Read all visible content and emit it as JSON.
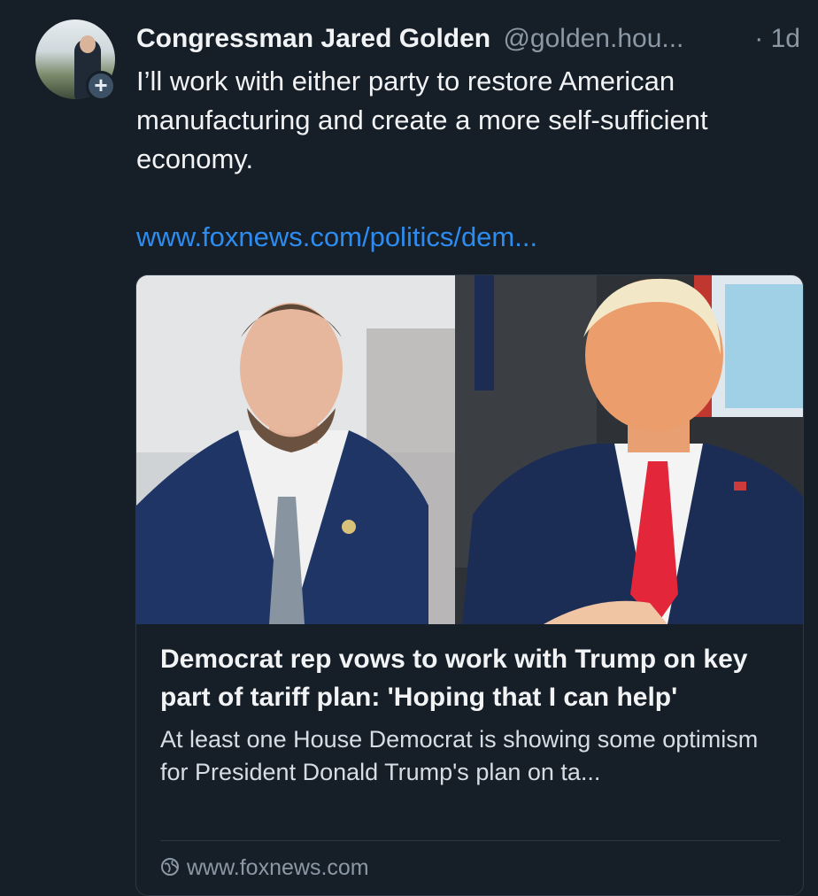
{
  "post": {
    "author_name": "Congressman Jared Golden",
    "author_handle": "@golden.hou...",
    "timestamp": "· 1d",
    "text": "I’ll work with either party to restore American manufacturing and create a more self-sufficient economy.",
    "link_text": "www.foxnews.com/politics/dem...",
    "follow_icon": "plus-icon"
  },
  "card": {
    "title": "Democrat rep vows to work with Trump on key part of tariff plan: 'Hoping that I can help'",
    "description": "At least one House Democrat is showing some optimism for President Donald Trump's plan on ta...",
    "domain": "www.foxnews.com",
    "domain_icon": "globe-icon"
  },
  "colors": {
    "background": "#161e27",
    "link": "#2d8cf0",
    "muted": "#8b98a5",
    "border": "#2b3744"
  }
}
